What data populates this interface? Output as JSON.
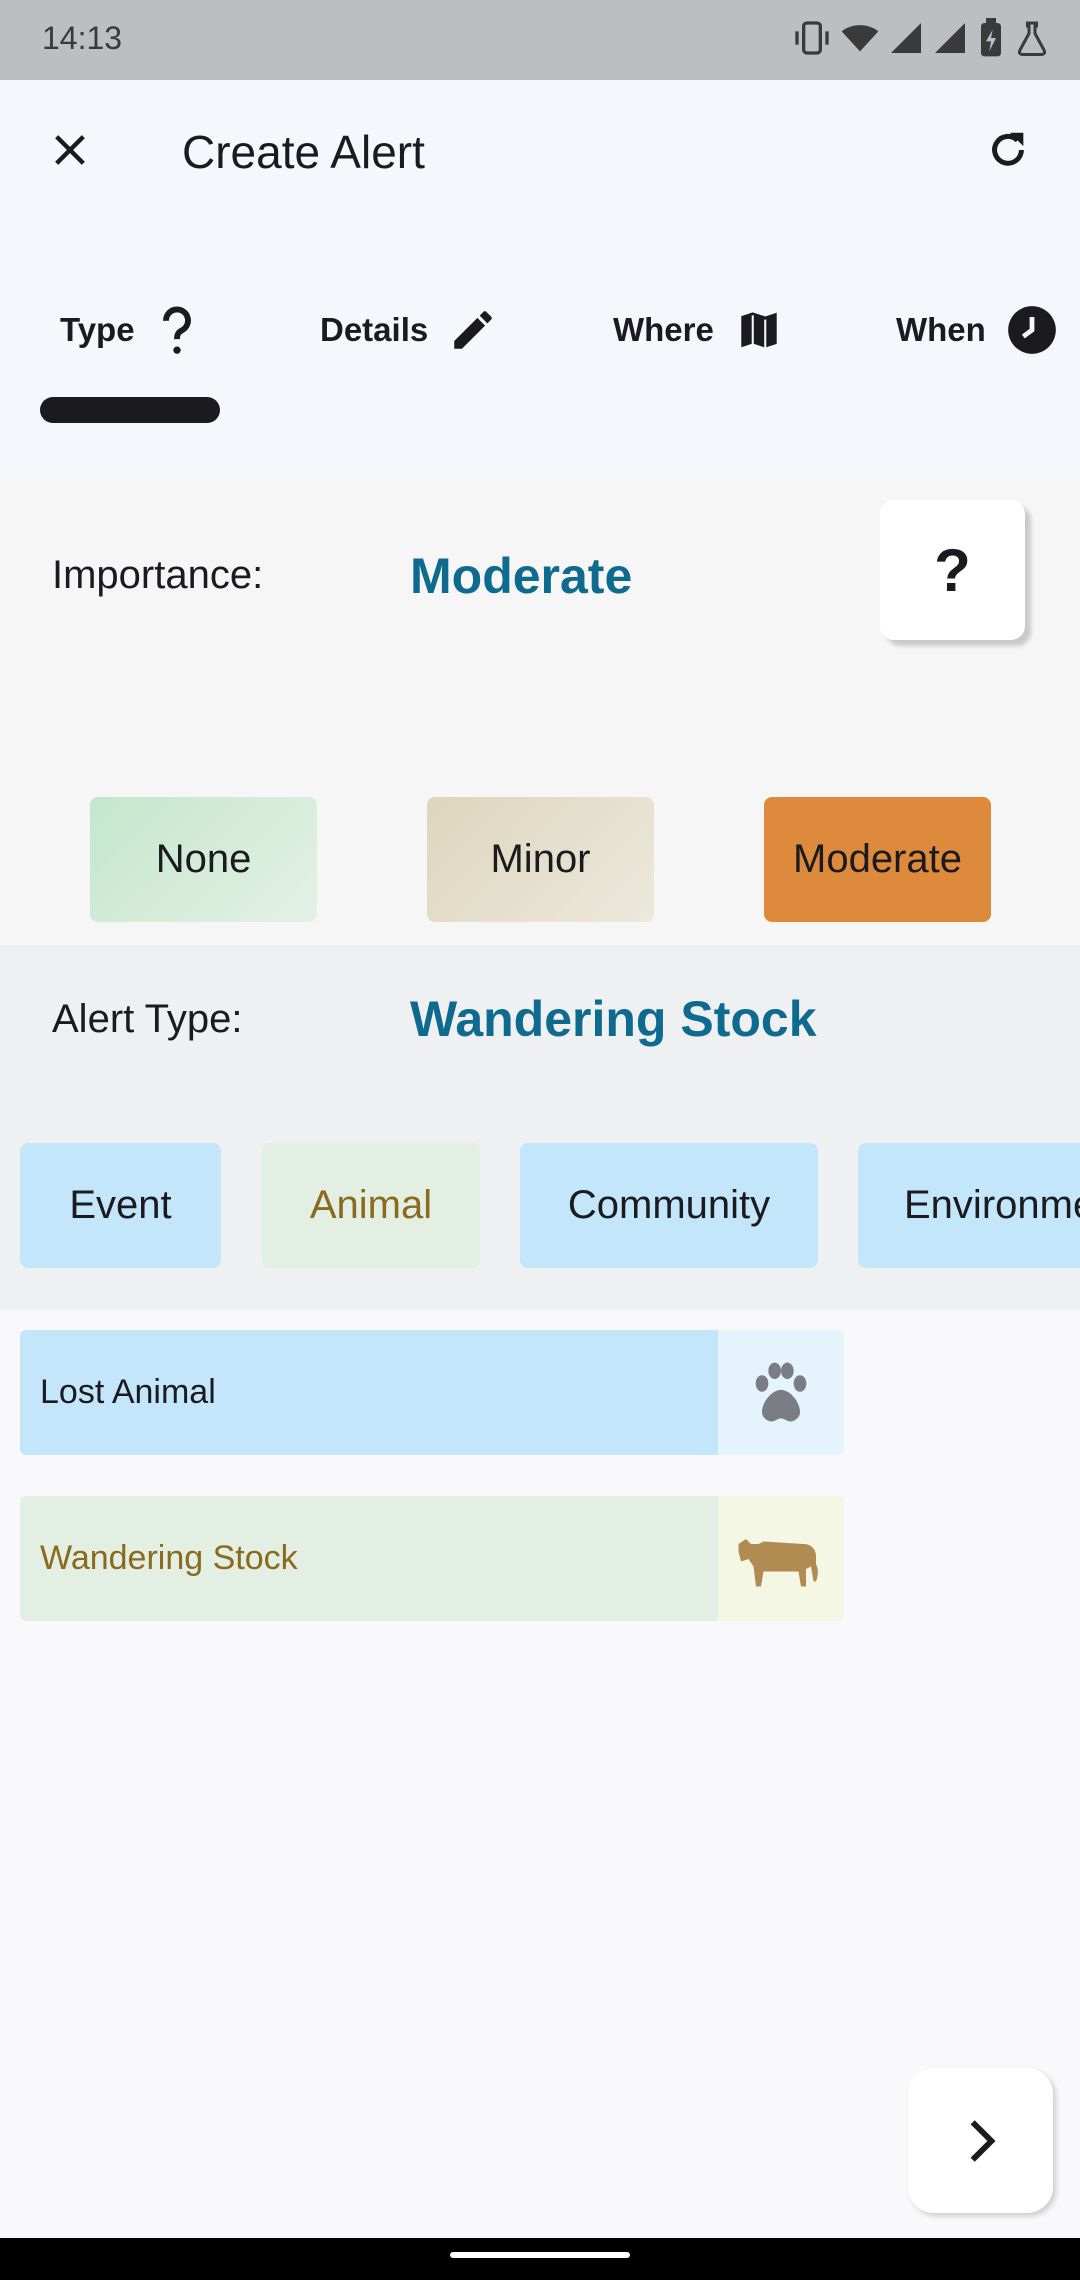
{
  "status_bar": {
    "time": "14:13"
  },
  "app_bar": {
    "title": "Create Alert"
  },
  "tabs": [
    {
      "label": "Type",
      "icon": "question-icon"
    },
    {
      "label": "Details",
      "icon": "pencil-icon"
    },
    {
      "label": "Where",
      "icon": "map-icon"
    },
    {
      "label": "When",
      "icon": "clock-icon"
    }
  ],
  "importance": {
    "label": "Importance:",
    "value": "Moderate",
    "help": "?",
    "options": [
      {
        "label": "None",
        "color": "#cfe9d5"
      },
      {
        "label": "Minor",
        "color": "#e3ddc8"
      },
      {
        "label": "Moderate",
        "color": "#dd8a3c"
      }
    ]
  },
  "alert_type": {
    "label": "Alert Type:",
    "value": "Wandering Stock",
    "categories": [
      {
        "label": "Event"
      },
      {
        "label": "Animal"
      },
      {
        "label": "Community"
      },
      {
        "label": "Environment"
      }
    ]
  },
  "subtypes": [
    {
      "label": "Lost Animal",
      "icon": "paw-icon"
    },
    {
      "label": "Wandering Stock",
      "icon": "cow-icon"
    }
  ],
  "colors": {
    "accent": "#0e6a8f",
    "selected_text": "#8a6a1e",
    "chip_blue": "#c4e6fb",
    "chip_green": "#e2efe2"
  }
}
